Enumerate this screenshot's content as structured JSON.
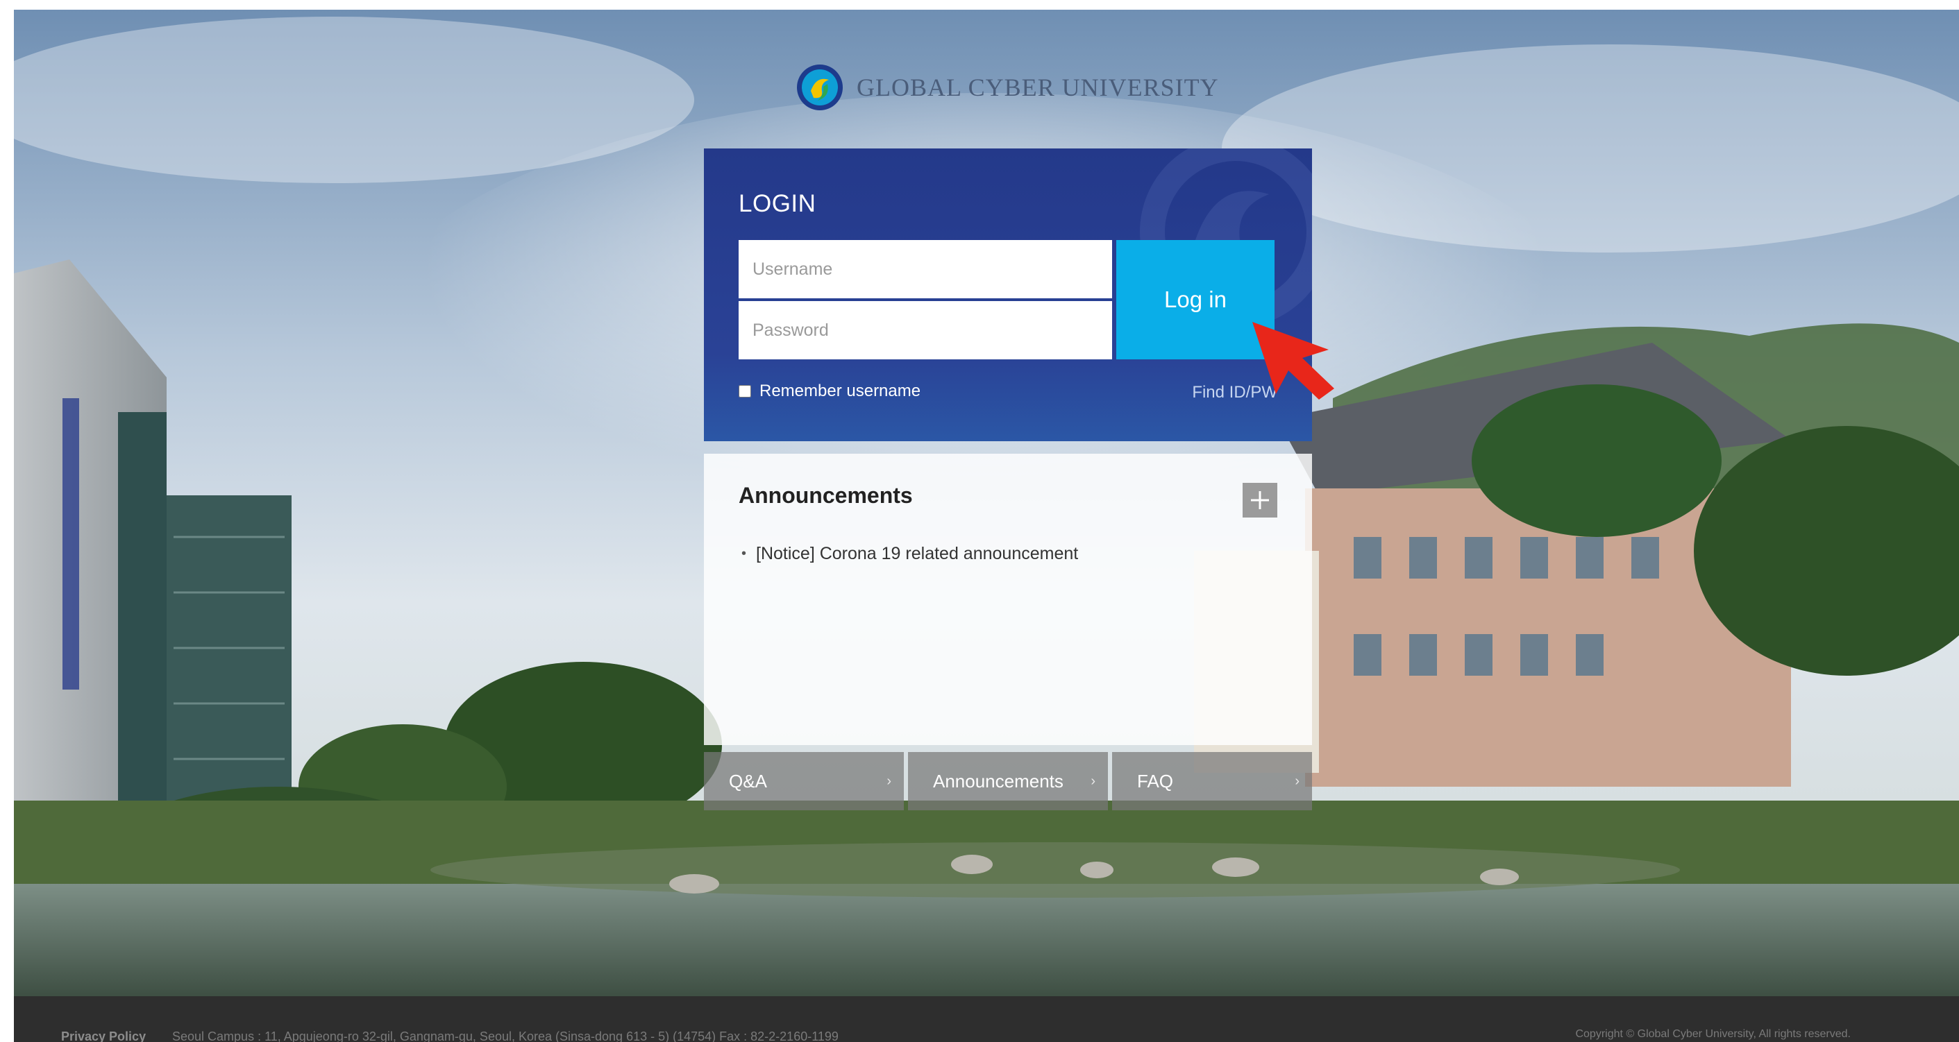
{
  "header": {
    "logo_text": "GLOBAL CYBER UNIVERSITY"
  },
  "login": {
    "title": "LOGIN",
    "username_placeholder": "Username",
    "password_placeholder": "Password",
    "username_value": "",
    "password_value": "",
    "login_button": "Log in",
    "remember_label": "Remember username",
    "remember_checked": false,
    "find_link": "Find ID/PW"
  },
  "announcements": {
    "title": "Announcements",
    "more_icon": "plus-icon",
    "items": [
      {
        "text": "[Notice] Corona 19 related announcement"
      }
    ]
  },
  "quick_links": [
    {
      "label": "Q&A"
    },
    {
      "label": "Announcements"
    },
    {
      "label": "FAQ"
    }
  ],
  "footer": {
    "privacy": "Privacy Policy",
    "address": "Seoul Campus : 11, Apgujeong-ro 32-gil, Gangnam-gu, Seoul, Korea (Sinsa-dong 613 - 5) (14754)   Fax : 82-2-2160-1199",
    "copyright": "Copyright © Global Cyber University, All rights reserved."
  },
  "colors": {
    "login_panel": "#24398a",
    "login_button": "#0aaee8",
    "cursor_arrow": "#e8261a",
    "footer": "#2e2e2e"
  }
}
